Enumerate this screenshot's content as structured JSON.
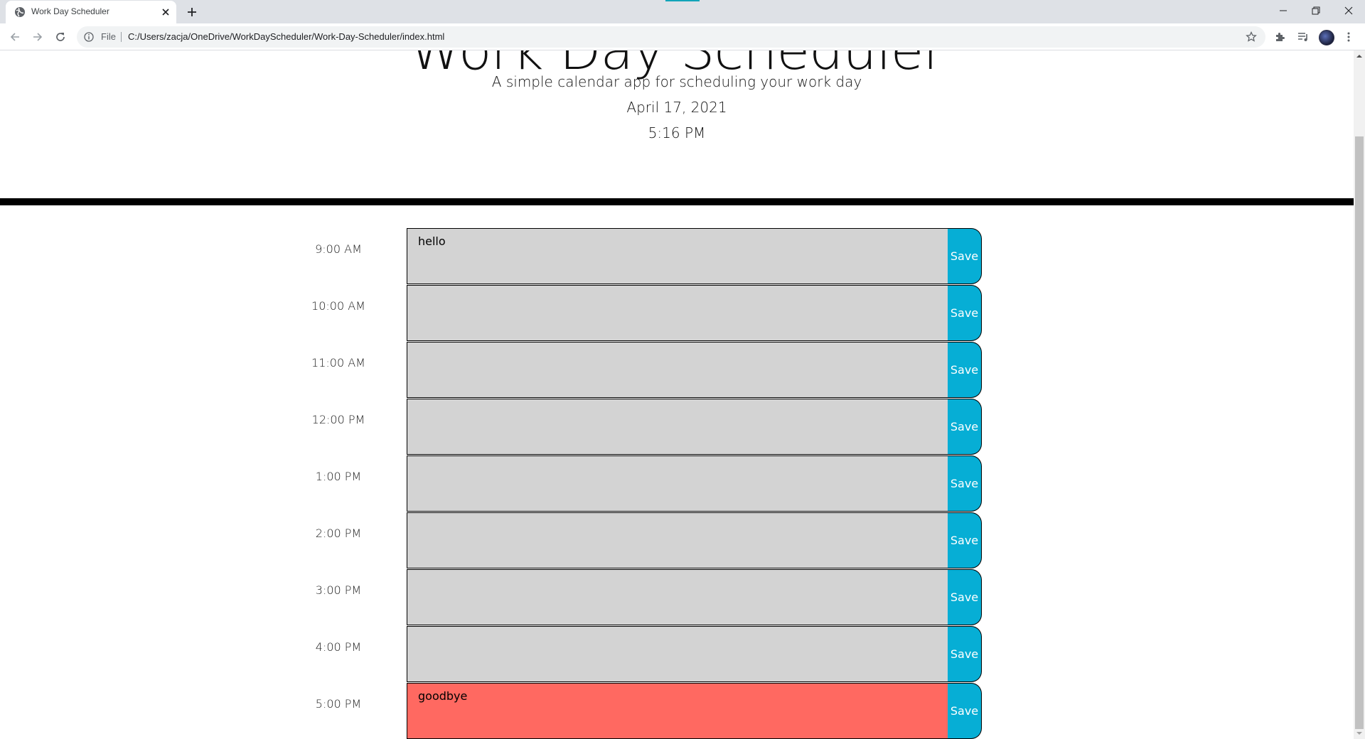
{
  "browser": {
    "tab_title": "Work Day Scheduler",
    "scheme_label": "File",
    "url": "C:/Users/zacja/OneDrive/WorkDayScheduler/Work-Day-Scheduler/index.html"
  },
  "header": {
    "title": "Work Day Scheduler",
    "lead": "A simple calendar app for scheduling your work day",
    "date": "April 17, 2021",
    "time": "5:16 PM"
  },
  "schedule": {
    "save_label": "Save",
    "rows": [
      {
        "hour": "9:00 AM",
        "text": "hello",
        "state": "past"
      },
      {
        "hour": "10:00 AM",
        "text": "",
        "state": "past"
      },
      {
        "hour": "11:00 AM",
        "text": "",
        "state": "past"
      },
      {
        "hour": "12:00 PM",
        "text": "",
        "state": "past"
      },
      {
        "hour": "1:00 PM",
        "text": "",
        "state": "past"
      },
      {
        "hour": "2:00 PM",
        "text": "",
        "state": "past"
      },
      {
        "hour": "3:00 PM",
        "text": "",
        "state": "past"
      },
      {
        "hour": "4:00 PM",
        "text": "",
        "state": "past"
      },
      {
        "hour": "5:00 PM",
        "text": "goodbye",
        "state": "present"
      }
    ]
  },
  "colors": {
    "past": "#d3d3d3",
    "present": "#ff6961",
    "save_button": "#06aed5",
    "tab_indicator": "#12a4b8"
  }
}
